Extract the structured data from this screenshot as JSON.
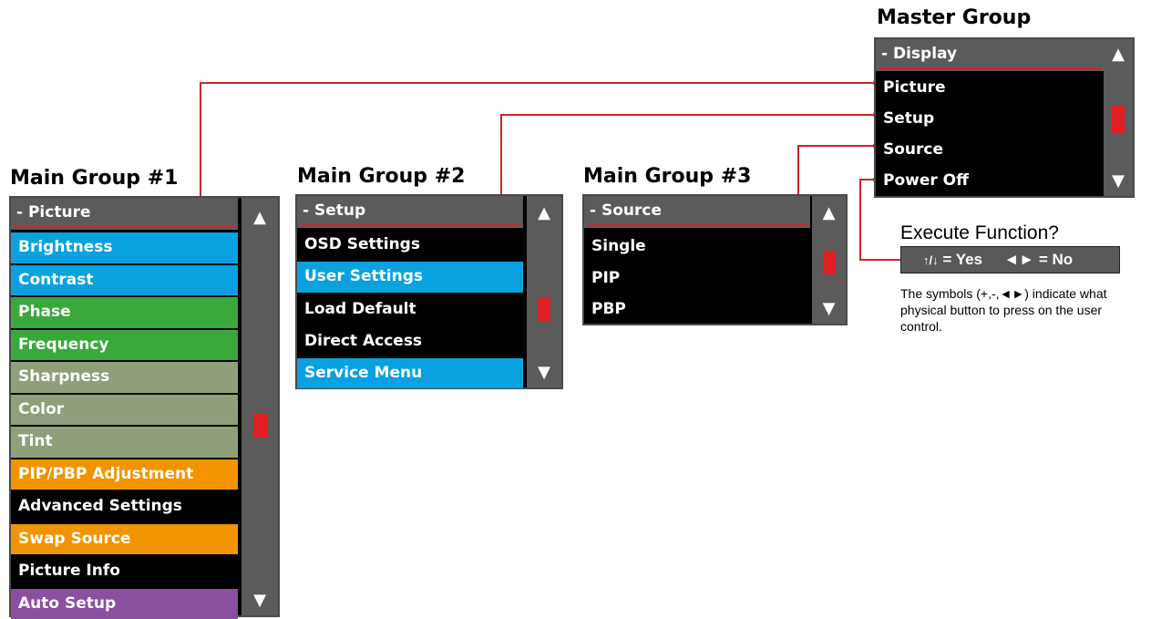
{
  "headings": {
    "master": "Master Group",
    "main1": "Main Group #1",
    "main2": "Main Group #2",
    "main3": "Main Group #3"
  },
  "master_panel": {
    "header": "- Display",
    "items": [
      {
        "label": "Picture"
      },
      {
        "label": "Setup"
      },
      {
        "label": "Source"
      },
      {
        "label": "Power Off"
      }
    ]
  },
  "main1_panel": {
    "header": "- Picture",
    "items": [
      {
        "label": "Brightness",
        "color": "#0aa1e0"
      },
      {
        "label": "Contrast",
        "color": "#0aa1e0"
      },
      {
        "label": "Phase",
        "color": "#38a93a"
      },
      {
        "label": "Frequency",
        "color": "#38a93a"
      },
      {
        "label": "Sharpness",
        "color": "#8f9f7a"
      },
      {
        "label": "Color",
        "color": "#8f9f7a"
      },
      {
        "label": "Tint",
        "color": "#8f9f7a"
      },
      {
        "label": "PIP/PBP Adjustment",
        "color": "#f29400"
      },
      {
        "label": "Advanced Settings",
        "color": "#000000"
      },
      {
        "label": "Swap Source",
        "color": "#f29400"
      },
      {
        "label": "Picture Info",
        "color": "#000000"
      },
      {
        "label": "Auto Setup",
        "color": "#8b4f9f"
      }
    ]
  },
  "main2_panel": {
    "header": "- Setup",
    "items": [
      {
        "label": "OSD Settings",
        "color": "#000000"
      },
      {
        "label": "User Settings",
        "color": "#0aa1e0"
      },
      {
        "label": "Load Default",
        "color": "#000000"
      },
      {
        "label": "Direct Access",
        "color": "#000000"
      },
      {
        "label": "Service Menu",
        "color": "#0aa1e0"
      }
    ]
  },
  "main3_panel": {
    "header": "- Source",
    "items": [
      {
        "label": "Single"
      },
      {
        "label": "PIP"
      },
      {
        "label": "PBP"
      }
    ]
  },
  "scroll_arrows": {
    "up": "▲",
    "down": "▼"
  },
  "execute": {
    "title": "Execute Function?",
    "symbol": "↑/↓",
    "yes_text": "= Yes",
    "no_text": "◄► = No",
    "note": "The symbols (+,-,◄►) indicate what physical button to press on the user control."
  },
  "colors": {
    "connector": "#d2232a",
    "panel_header": "#5b5b5b",
    "scroll_thumb": "#e01e26"
  }
}
